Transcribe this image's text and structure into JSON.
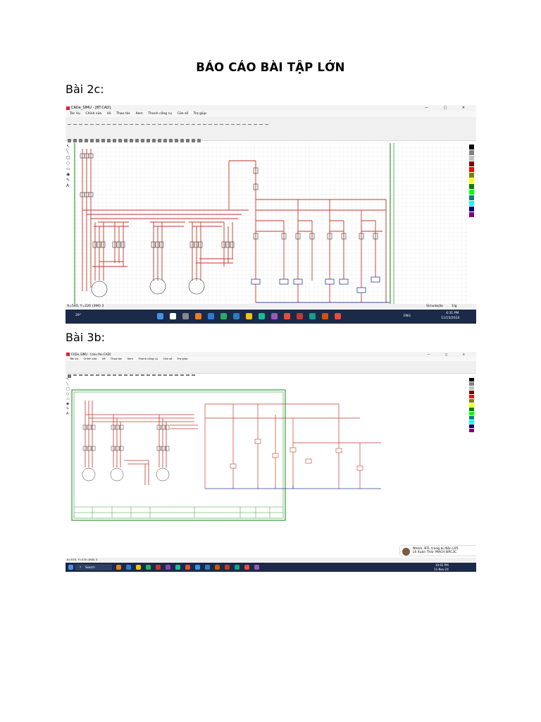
{
  "document": {
    "title": "BÁO CÁO BÀI TẬP LỚN",
    "section_2c": "Bài 2c:",
    "section_3b": "Bài 3b:"
  },
  "shot1": {
    "window_title": "CADe_SIMU - [BT.CAD]",
    "menu": [
      "Tác Vụ",
      "Chỉnh sửa",
      "Vẽ",
      "Thao tác",
      "Xem",
      "Thanh công cụ",
      "Cửa sổ",
      "Trợ giúp"
    ],
    "status_coords": "X=540, Y=220 (396) 3",
    "status_mode": "Simulação",
    "status_extra": "1/g",
    "tray_lang": "ENG",
    "tray_time": "4:31 PM",
    "tray_date": "11/15/2024",
    "weather": "29°"
  },
  "shot2": {
    "window_title": "CADe_SIMU - [sieu tho.CAD]",
    "menu": [
      "Tác Vụ",
      "Chỉnh sửa",
      "Vẽ",
      "Thao tác",
      "Xem",
      "Thanh công cụ",
      "Cửa sổ",
      "Trợ giúp"
    ],
    "status_coords": "X=575, Y=370 (490) 3",
    "taskbar_search": "Search",
    "chat_message": "Nhóm: BTL trang bị điện L05",
    "chat_sender": "Lê Xuân Thái: MẠCH BÁC3C",
    "tray_time": "10:02 PM",
    "tray_date": "11-Nov-24"
  },
  "colors": {
    "wire_red": "#c0392b",
    "wire_blue": "#2c3e9e",
    "border_green": "#3a9a3a",
    "grid": "#e4e4e4",
    "taskbar": "#1c2a4a"
  },
  "palette": [
    "#000000",
    "#808080",
    "#c0c0c0",
    "#800000",
    "#ff0000",
    "#808000",
    "#ffff00",
    "#008000",
    "#00ff00",
    "#008080",
    "#00ffff",
    "#000080",
    "#800080"
  ]
}
